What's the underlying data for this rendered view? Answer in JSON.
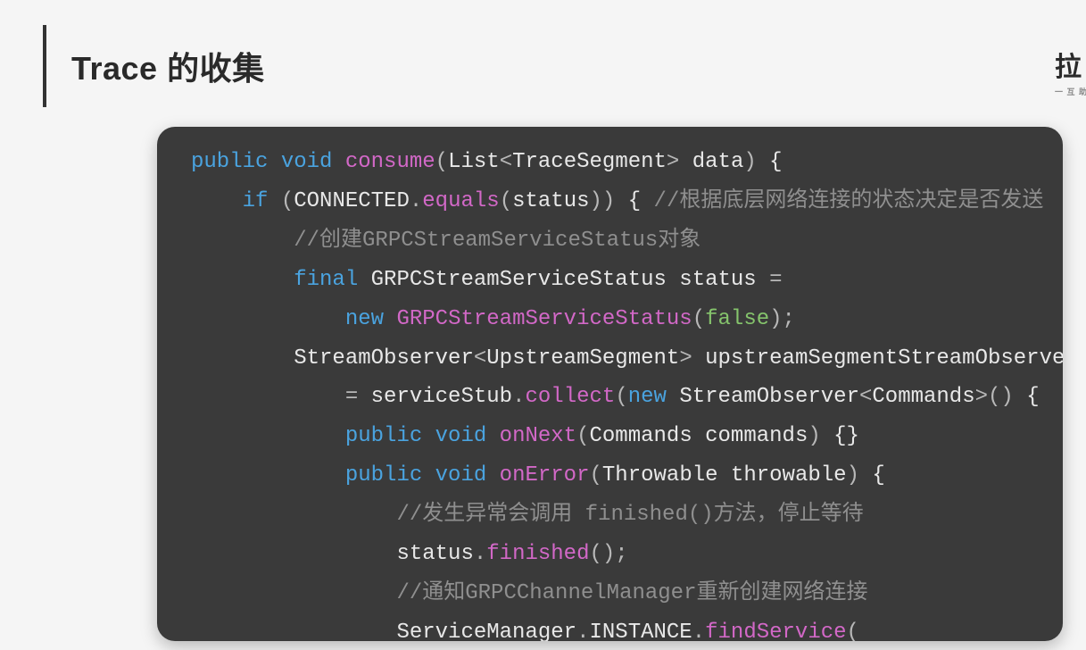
{
  "title": "Trace 的收集",
  "brand": "拉",
  "brand_sub": "一   互 助",
  "code": {
    "l1": {
      "kw1": "public",
      "kw2": "void",
      "fn": "consume",
      "p1": "(",
      "t1": "List",
      "ang1": "<",
      "t2": "TraceSegment",
      "ang2": ">",
      "sp": " ",
      "id": "data",
      "p2": ")",
      "br": " {"
    },
    "l2": {
      "pad": "    ",
      "kw": "if",
      "p1": " (",
      "id1": "CONNECTED",
      "dot": ".",
      "fn": "equals",
      "p2": "(",
      "id2": "status",
      "p3": "))",
      "br": " {",
      "cm": " //根据底层网络连接的状态决定是否发送"
    },
    "l3": {
      "pad": "        ",
      "cm": "//创建GRPCStreamServiceStatus对象"
    },
    "l4": {
      "pad": "        ",
      "kw": "final",
      "t": " GRPCStreamServiceStatus ",
      "id": "status ",
      "eq": "="
    },
    "l5": {
      "pad": "            ",
      "kw": "new",
      "sp": " ",
      "fn": "GRPCStreamServiceStatus",
      "p1": "(",
      "lit": "false",
      "p2": ");"
    },
    "l6": {
      "pad": "        ",
      "t1": "StreamObserver",
      "ang1": "<",
      "t2": "UpstreamSegment",
      "ang2": ">",
      "sp": " ",
      "id": "upstreamSegmentStreamObserver"
    },
    "l7": {
      "pad": "            ",
      "eq": "= ",
      "id1": "serviceStub",
      "dot1": ".",
      "fn": "collect",
      "p1": "(",
      "kw": "new",
      "sp": " ",
      "t": "StreamObserver",
      "ang1": "<",
      "t2": "Commands",
      "ang2": ">",
      "p2": "()",
      "br": " {"
    },
    "l8": {
      "pad": "            ",
      "kw1": "public",
      "kw2": " void",
      "sp": " ",
      "fn": "onNext",
      "p1": "(",
      "t": "Commands ",
      "id": "commands",
      "p2": ")",
      "br": " {}"
    },
    "l9": {
      "pad": "            ",
      "kw1": "public",
      "kw2": " void",
      "sp": " ",
      "fn": "onError",
      "p1": "(",
      "t": "Throwable ",
      "id": "throwable",
      "p2": ")",
      "br": " {"
    },
    "l10": {
      "pad": "                ",
      "cm": "//发生异常会调用 finished()方法，停止等待"
    },
    "l11": {
      "pad": "                ",
      "id": "status",
      "dot": ".",
      "fn": "finished",
      "p": "();"
    },
    "l12": {
      "pad": "                ",
      "cm": "//通知GRPCChannelManager重新创建网络连接"
    },
    "l13": {
      "pad": "                ",
      "id1": "ServiceManager",
      "dot1": ".",
      "id2": "INSTANCE",
      "dot2": ".",
      "fn": "findService",
      "p": "("
    }
  }
}
